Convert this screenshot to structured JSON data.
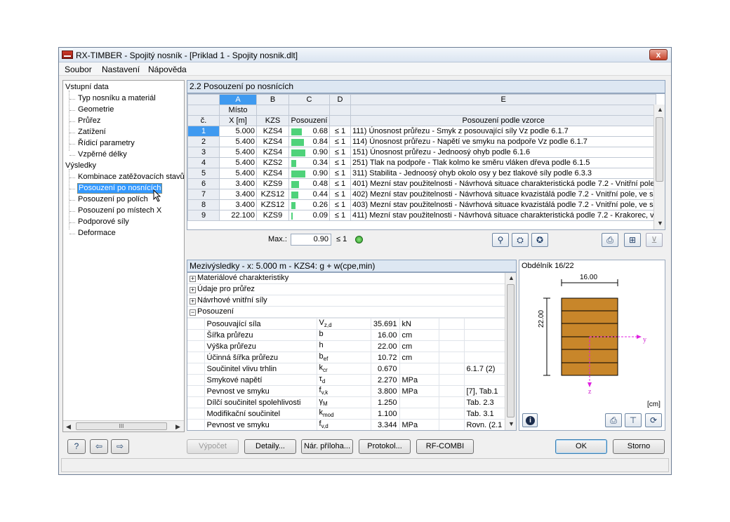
{
  "window": {
    "title": "RX-TIMBER - Spojitý nosník - [Priklad 1 - Spojity nosnik.dlt]",
    "close": "x"
  },
  "menu": [
    "Soubor",
    "Nastavení",
    "Nápověda"
  ],
  "tree": {
    "input_root": "Vstupní data",
    "input_items": [
      "Typ nosníku a materiál",
      "Geometrie",
      "Průřez",
      "Zatížení",
      "Řídicí parametry",
      "Vzpěrné délky"
    ],
    "results_root": "Výsledky",
    "results_items": [
      "Kombinace zatěžovacích stavů",
      "Posouzení po nosnících",
      "Posouzení po polích",
      "Posouzení po místech X",
      "Podporové síly",
      "Deformace"
    ],
    "scroll_thumb": "III"
  },
  "upper": {
    "title": "2.2 Posouzení po nosnících",
    "col_letters": [
      "A",
      "B",
      "C",
      "D",
      "E"
    ],
    "col_no": "č.",
    "col_x_1": "Místo",
    "col_x_2": "X [m]",
    "col_kzs": "KZS",
    "col_posouzeni": "Posouzení",
    "col_formula": "Posouzení podle vzorce",
    "rows": [
      {
        "n": "1",
        "x": "5.000",
        "kzs": "KZS4",
        "r": "0.68",
        "f": 0.68,
        "le": "≤ 1",
        "e": "111) Únosnost průřezu - Smyk z posouvající síly Vz podle 6.1.7"
      },
      {
        "n": "2",
        "x": "5.400",
        "kzs": "KZS4",
        "r": "0.84",
        "f": 0.84,
        "le": "≤ 1",
        "e": "114) Únosnost průřezu - Napětí ve smyku na podpoře Vz podle 6.1.7"
      },
      {
        "n": "3",
        "x": "5.400",
        "kzs": "KZS4",
        "r": "0.90",
        "f": 0.9,
        "le": "≤ 1",
        "e": "151) Únosnost průřezu - Jednoosý ohyb podle 6.1.6"
      },
      {
        "n": "4",
        "x": "5.400",
        "kzs": "KZS2",
        "r": "0.34",
        "f": 0.34,
        "le": "≤ 1",
        "e": "251) Tlak na podpoře - Tlak kolmo ke směru vláken dřeva podle 6.1.5"
      },
      {
        "n": "5",
        "x": "5.400",
        "kzs": "KZS4",
        "r": "0.90",
        "f": 0.9,
        "le": "≤ 1",
        "e": "311) Stabilita - Jednoosý ohyb okolo osy y bez tlakové síly podle 6.3.3"
      },
      {
        "n": "6",
        "x": "3.400",
        "kzs": "KZS9",
        "r": "0.48",
        "f": 0.48,
        "le": "≤ 1",
        "e": "401) Mezní stav použitelnosti - Návrhová situace charakteristická podle 7.2 - Vnitřní pole"
      },
      {
        "n": "7",
        "x": "3.400",
        "kzs": "KZS12",
        "r": "0.44",
        "f": 0.44,
        "le": "≤ 1",
        "e": "402) Mezní stav použitelnosti - Návrhová situace kvazistálá podle 7.2 - Vnitřní pole, ve s"
      },
      {
        "n": "8",
        "x": "3.400",
        "kzs": "KZS12",
        "r": "0.26",
        "f": 0.26,
        "le": "≤ 1",
        "e": "403) Mezní stav použitelnosti - Návrhová situace kvazistálá podle 7.2 - Vnitřní pole, ve s"
      },
      {
        "n": "9",
        "x": "22.100",
        "kzs": "KZS9",
        "r": "0.09",
        "f": 0.09,
        "le": "≤ 1",
        "e": "411) Mezní stav použitelnosti - Návrhová situace charakteristická podle 7.2 - Krakorec, v"
      }
    ],
    "max_label": "Max.:",
    "max_value": "0.90",
    "max_le": "≤ 1"
  },
  "detail": {
    "title": "Mezivýsledky  -  x: 5.000 m  -  KZS4: g + w(cpe,min)",
    "groups": [
      "Materiálové charakteristiky",
      "Údaje pro průřez",
      "Návrhové vnitřní síly",
      "Posouzení"
    ],
    "rows": [
      {
        "name": "Posouvající síla",
        "sym": "V",
        "sub": "z,d",
        "val": "35.691",
        "unit": "kN",
        "ref": ""
      },
      {
        "name": "Šířka průřezu",
        "sym": "b",
        "sub": "",
        "val": "16.00",
        "unit": "cm",
        "ref": ""
      },
      {
        "name": "Výška průřezu",
        "sym": "h",
        "sub": "",
        "val": "22.00",
        "unit": "cm",
        "ref": ""
      },
      {
        "name": "Účinná šířka průřezu",
        "sym": "b",
        "sub": "ef",
        "val": "10.72",
        "unit": "cm",
        "ref": ""
      },
      {
        "name": "Součinitel vlivu trhlin",
        "sym": "k",
        "sub": "cr",
        "val": "0.670",
        "unit": "",
        "ref": "6.1.7 (2)"
      },
      {
        "name": "Smykové napětí",
        "sym": "τ",
        "sub": "d",
        "val": "2.270",
        "unit": "MPa",
        "ref": ""
      },
      {
        "name": "Pevnost ve smyku",
        "sym": "f",
        "sub": "v,k",
        "val": "3.800",
        "unit": "MPa",
        "ref": "[7], Tab.1"
      },
      {
        "name": "Dílčí součinitel spolehlivosti",
        "sym": "γ",
        "sub": "M",
        "val": "1.250",
        "unit": "",
        "ref": "Tab. 2.3"
      },
      {
        "name": "Modifikační součinitel",
        "sym": "k",
        "sub": "mod",
        "val": "1.100",
        "unit": "",
        "ref": "Tab. 3.1"
      },
      {
        "name": "Pevnost ve smyku",
        "sym": "f",
        "sub": "v,d",
        "val": "3.344",
        "unit": "MPa",
        "ref": "Rovn. (2.1"
      }
    ]
  },
  "section": {
    "title": "Obdélník 16/22",
    "width_label": "16.00",
    "height_label": "22.00",
    "y_axis": "y",
    "z_axis": "z",
    "unit": "[cm]",
    "info": "i",
    "fill": "#c8862a"
  },
  "buttons": {
    "vypocet": "Výpočet",
    "detaily": "Detaily...",
    "priloha": "Nár. příloha...",
    "protokol": "Protokol...",
    "rfcombi": "RF-COMBI",
    "ok": "OK",
    "storno": "Storno"
  }
}
